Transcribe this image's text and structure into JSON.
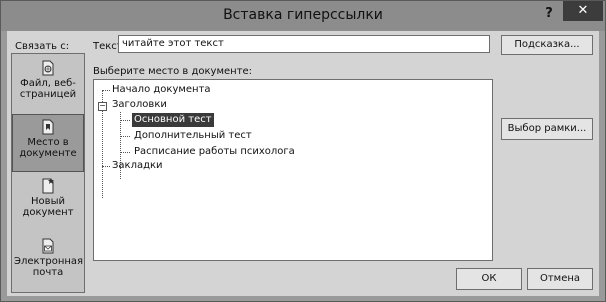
{
  "window": {
    "title": "Вставка гиперссылки",
    "help_label": "?",
    "close_label": "✕"
  },
  "link_to": {
    "label": "Связать с:",
    "items": [
      {
        "label": "Файл, веб-страницей",
        "icon": "file-web-icon"
      },
      {
        "label": "Место в документе",
        "icon": "bookmark-place-icon",
        "selected": true
      },
      {
        "label": "Новый документ",
        "icon": "new-document-icon"
      },
      {
        "label": "Электронная почта",
        "icon": "email-icon"
      }
    ]
  },
  "text_field": {
    "label": "Текст:",
    "value": "читайте этот текст"
  },
  "buttons": {
    "hint": "Подсказка...",
    "frame": "Выбор рамки...",
    "ok": "ОК",
    "cancel": "Отмена"
  },
  "place": {
    "label": "Выберите место в документе:",
    "tree": {
      "top": "Начало документа",
      "headings": "Заголовки",
      "heading_items": [
        "Основной тест",
        "Дополнительный тест",
        "Расписание работы психолога"
      ],
      "bookmarks": "Закладки",
      "selected": "Основной тест"
    }
  }
}
